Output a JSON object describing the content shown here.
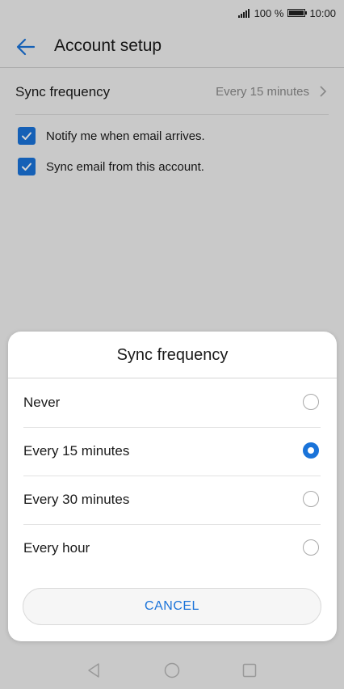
{
  "status_bar": {
    "battery_percent": "100 %",
    "time": "10:00"
  },
  "app_bar": {
    "title": "Account setup"
  },
  "settings": {
    "sync_frequency_label": "Sync frequency",
    "sync_frequency_value": "Every 15 minutes",
    "checkboxes": [
      {
        "label": "Notify me when email arrives.",
        "checked": true
      },
      {
        "label": "Sync email from this account.",
        "checked": true
      }
    ]
  },
  "dialog": {
    "title": "Sync frequency",
    "options": [
      {
        "label": "Never",
        "selected": false
      },
      {
        "label": "Every 15 minutes",
        "selected": true
      },
      {
        "label": "Every 30 minutes",
        "selected": false
      },
      {
        "label": "Every hour",
        "selected": false
      }
    ],
    "cancel_label": "CANCEL"
  },
  "colors": {
    "accent": "#1a73d9"
  },
  "icons": [
    "signal-icon",
    "battery-icon",
    "back-arrow-icon",
    "chevron-right-icon",
    "checkmark-icon",
    "nav-back-icon",
    "nav-home-icon",
    "nav-recents-icon"
  ]
}
